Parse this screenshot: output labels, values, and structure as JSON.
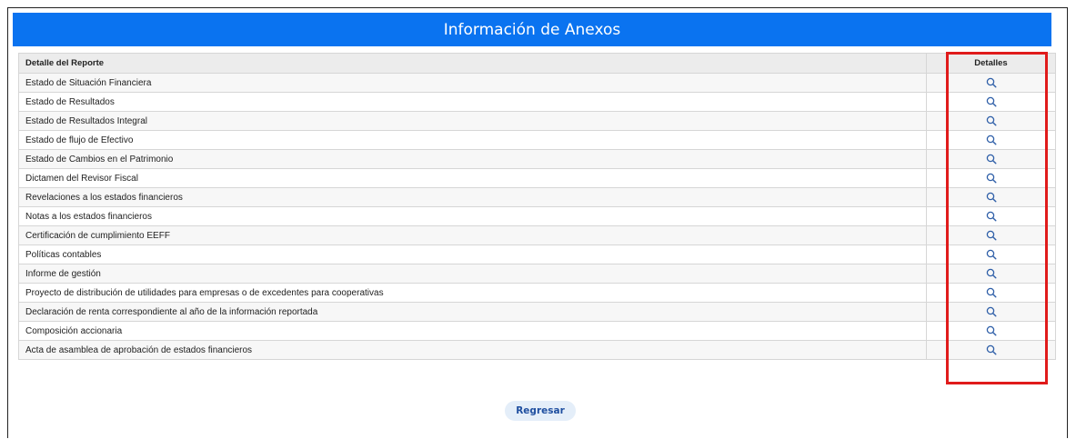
{
  "header": {
    "title": "Información de Anexos"
  },
  "table": {
    "columns": [
      "Detalle del Reporte",
      "Detalles"
    ],
    "rows": [
      {
        "label": "Estado de Situación Financiera",
        "icon": "search-icon"
      },
      {
        "label": "Estado de Resultados",
        "icon": "search-icon"
      },
      {
        "label": "Estado de Resultados Integral",
        "icon": "search-icon"
      },
      {
        "label": "Estado de flujo de Efectivo",
        "icon": "search-icon"
      },
      {
        "label": "Estado de Cambios en el Patrimonio",
        "icon": "search-icon"
      },
      {
        "label": "Dictamen del Revisor Fiscal",
        "icon": "search-icon"
      },
      {
        "label": "Revelaciones a los estados financieros",
        "icon": "search-icon"
      },
      {
        "label": "Notas a los estados financieros",
        "icon": "search-icon"
      },
      {
        "label": "Certificación de cumplimiento EEFF",
        "icon": "search-icon"
      },
      {
        "label": "Políticas contables",
        "icon": "search-icon"
      },
      {
        "label": "Informe de gestión",
        "icon": "search-icon"
      },
      {
        "label": "Proyecto de distribución de utilidades para empresas o de excedentes para cooperativas",
        "icon": "search-icon"
      },
      {
        "label": "Declaración de renta correspondiente al año de la información reportada",
        "icon": "search-icon"
      },
      {
        "label": "Composición accionaria",
        "icon": "search-icon"
      },
      {
        "label": "Acta de asamblea de aprobación de estados financieros",
        "icon": "search-icon"
      }
    ]
  },
  "actions": {
    "back_label": "Regresar"
  },
  "colors": {
    "header_bg": "#0a73f0",
    "highlight_border": "#e01b1b",
    "icon": "#2f5fa8",
    "back_button_bg": "#e4eef9"
  }
}
